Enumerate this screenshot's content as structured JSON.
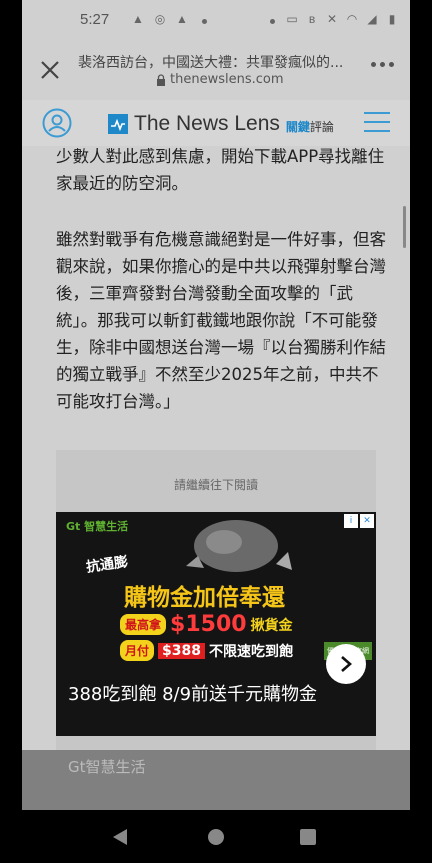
{
  "status_bar": {
    "time": "5:27"
  },
  "browser": {
    "page_title": "裴洛西訪台，中國送大禮：共軍發瘋似的...",
    "url": "thenewslens.com"
  },
  "site": {
    "logo_text": "The News Lens",
    "logo_sub_highlight": "關鍵",
    "logo_sub_rest": "評論",
    "accent_color": "#1e88c8"
  },
  "article": {
    "paragraphs": [
      "少數人對此感到焦慮，開始下載APP尋找離住家最近的防空洞。",
      "雖然對戰爭有危機意識絕對是一件好事，但客觀來說，如果你擔心的是中共以飛彈射擊台灣後，三軍齊發對台灣發動全面攻擊的「武統」。那我可以斬釘截鐵地跟你說「不可能發生，除非中國想送台灣一場『以台獨勝利作結的獨立戰爭』不然至少2025年之前，中共不可能攻打台灣。」"
    ]
  },
  "ad": {
    "continue_label": "請繼續往下閱讀",
    "brand": "Gt 智慧生活",
    "headline": "抗通膨",
    "main_text": "購物金加倍奉還",
    "price_pill": "最高拿",
    "price": "$1500",
    "price_label": "揪貨金",
    "sub_pill": "月付",
    "sub_price": "$388",
    "sub_label": "不限速吃到飽",
    "note": "優惠詳見官網",
    "caption": "388吃到飽 8/9前送千元購物金",
    "advertiser": "Gt智慧生活"
  }
}
